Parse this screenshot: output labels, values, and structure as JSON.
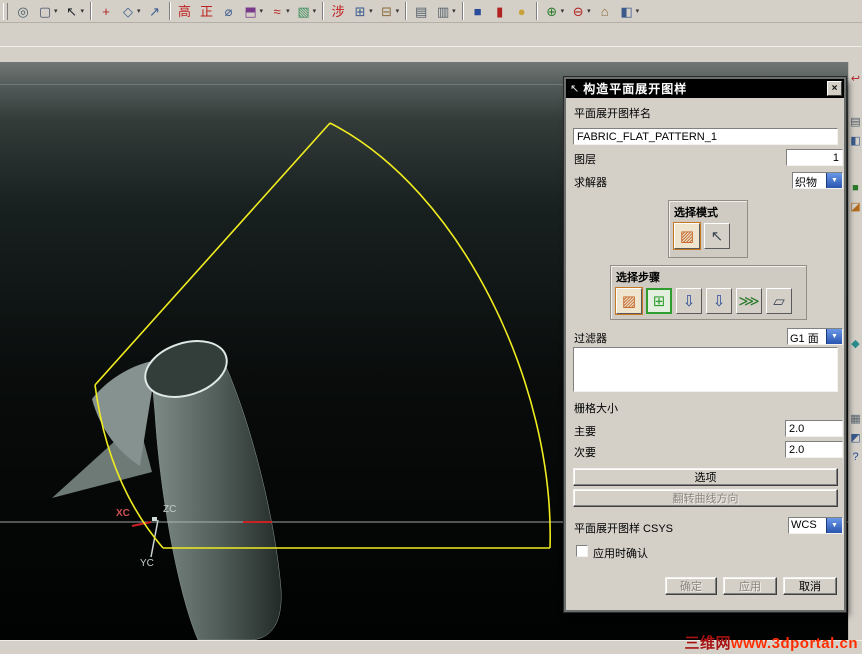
{
  "ui": {
    "dropdown_arrow": "▾",
    "combo_arrow": "▼",
    "close_glyph": "×",
    "title_icon": "↖"
  },
  "toolbar_row1": [
    {
      "grip": true
    },
    {
      "name": "open-part",
      "glyph": "▨",
      "color": "#2a3a55",
      "arrow": true
    },
    {
      "sep": true
    },
    {
      "name": "extrude",
      "glyph": "⬒",
      "color": "#3a5a8c"
    },
    {
      "name": "revolve",
      "glyph": "◑",
      "color": "#3a5a8c"
    },
    {
      "name": "block-feature",
      "glyph": "▣",
      "color": "#3a5a8c"
    },
    {
      "name": "cylinder-feature",
      "glyph": "▮",
      "color": "#3a5a8c",
      "arrow": true
    },
    {
      "name": "cone-feature",
      "glyph": "▲",
      "color": "#3a5a8c",
      "arrow": true
    },
    {
      "name": "sphere-feature",
      "glyph": "●",
      "color": "#3a5a8c"
    },
    {
      "sep": true
    },
    {
      "name": "sheet-body",
      "glyph": "▤",
      "color": "#5a6677"
    },
    {
      "name": "sketch",
      "glyph": "✎",
      "color": "#8a6d1a"
    },
    {
      "sep": true
    },
    {
      "name": "hole-feature",
      "glyph": "◎",
      "color": "#b22222"
    },
    {
      "name": "boss-feature",
      "glyph": "⊚",
      "color": "#3a5a8c"
    },
    {
      "name": "pocket-feature",
      "glyph": "⊟",
      "color": "#3a5a8c",
      "arrow": true
    },
    {
      "name": "pad-feature",
      "glyph": "⊞",
      "color": "#3a5a8c",
      "arrow": true
    },
    {
      "sep": true
    },
    {
      "name": "unite",
      "glyph": "⊕",
      "color": "#b8860b"
    },
    {
      "name": "subtract",
      "glyph": "⊖",
      "color": "#b22222"
    },
    {
      "name": "intersect",
      "glyph": "⊗",
      "color": "#2a7a2a"
    },
    {
      "sep": true
    },
    {
      "name": "edge-blend",
      "glyph": "◠",
      "color": "#3a5a8c",
      "arrow": true
    },
    {
      "name": "chamfer",
      "glyph": "◣",
      "color": "#3a5a8c"
    },
    {
      "name": "shell",
      "glyph": "▢",
      "color": "#3a5a8c"
    },
    {
      "name": "thread",
      "glyph": "≡",
      "color": "#5a6677"
    },
    {
      "sep": true
    },
    {
      "name": "trim-body",
      "glyph": "✂",
      "color": "#b22222"
    },
    {
      "name": "sew",
      "glyph": "≈",
      "color": "#2a7a2a"
    },
    {
      "name": "thicken",
      "glyph": "▦",
      "color": "#3a5a8c",
      "arrow": true
    },
    {
      "sep": true
    },
    {
      "name": "instance-array",
      "glyph": "▩",
      "color": "#7a3a8c"
    },
    {
      "name": "mirror-body",
      "glyph": "◫",
      "color": "#3a5a8c"
    },
    {
      "name": "red-solid",
      "glyph": "■",
      "color": "#b22222"
    },
    {
      "name": "gold-solid",
      "glyph": "■",
      "color": "#caa23a"
    },
    {
      "name": "green-face",
      "glyph": "◨",
      "color": "#2a7a2a"
    }
  ],
  "toolbar_row2": [
    {
      "grip": true
    },
    {
      "name": "snap-point",
      "glyph": "◎",
      "color": "#445a66"
    },
    {
      "name": "selection-rectangle",
      "glyph": "▢",
      "color": "#44506a",
      "arrow": true
    },
    {
      "name": "select-cursor",
      "glyph": "↖",
      "color": "#20262c",
      "arrow": true
    },
    {
      "sep": true
    },
    {
      "name": "point-constructor",
      "glyph": "+",
      "color": "#b22222"
    },
    {
      "name": "plane-constructor",
      "glyph": "◇",
      "color": "#3a5a8c",
      "arrow": true
    },
    {
      "name": "vector-constructor",
      "glyph": "↗",
      "color": "#3a5a8c"
    },
    {
      "sep": true
    },
    {
      "name": "height-analysis",
      "glyph": "高",
      "color": "#c02020"
    },
    {
      "name": "distortion-check",
      "glyph": "正",
      "color": "#c02020"
    },
    {
      "name": "measure-diameter",
      "glyph": "⌀",
      "color": "#3a5a8c"
    },
    {
      "name": "solid-display",
      "glyph": "⬒",
      "color": "#7a3a8c",
      "arrow": true
    },
    {
      "name": "curve-display",
      "glyph": "≈",
      "color": "#b22222",
      "arrow": true
    },
    {
      "name": "surface-display",
      "glyph": "▧",
      "color": "#3a8c5a",
      "arrow": true
    },
    {
      "sep": true
    },
    {
      "name": "flatten-step",
      "glyph": "涉",
      "color": "#c02020"
    },
    {
      "name": "pattern-grid",
      "glyph": "⊞",
      "color": "#3a5a8c",
      "arrow": true
    },
    {
      "name": "offset-grid",
      "glyph": "⊟",
      "color": "#8c6a3a",
      "arrow": true
    },
    {
      "sep": true
    },
    {
      "name": "info-window",
      "glyph": "▤",
      "color": "#55606a"
    },
    {
      "name": "layer-settings",
      "glyph": "▥",
      "color": "#55606a",
      "arrow": true
    },
    {
      "sep": true
    },
    {
      "name": "blue-solid",
      "glyph": "■",
      "color": "#2a4a9a"
    },
    {
      "name": "red-cylinder",
      "glyph": "▮",
      "color": "#b22222"
    },
    {
      "name": "gold-sphere",
      "glyph": "●",
      "color": "#caa23a"
    },
    {
      "sep": true
    },
    {
      "name": "boolean-add",
      "glyph": "⊕",
      "color": "#2a7a2a",
      "arrow": true
    },
    {
      "name": "boolean-cut",
      "glyph": "⊖",
      "color": "#b22222",
      "arrow": true
    },
    {
      "name": "wcs-origin",
      "glyph": "⌂",
      "color": "#8c6a3a"
    },
    {
      "name": "view-style",
      "glyph": "◧",
      "color": "#3a5a8c",
      "arrow": true
    }
  ],
  "right_toolbar": [
    {
      "gap": 8
    },
    {
      "name": "undo-view",
      "glyph": "↩",
      "color": "#b22222"
    },
    {
      "gap": 24
    },
    {
      "name": "list-pane",
      "glyph": "▤",
      "color": "#55606a"
    },
    {
      "name": "split-pane",
      "glyph": "◧",
      "color": "#3a5a8c"
    },
    {
      "gap": 28
    },
    {
      "name": "green-part",
      "glyph": "■",
      "color": "#2a7a2a"
    },
    {
      "name": "orange-part",
      "glyph": "◪",
      "color": "#b26a1a"
    },
    {
      "gap": 118
    },
    {
      "name": "teal-tool",
      "glyph": "◆",
      "color": "#2a8c8c"
    },
    {
      "gap": 56
    },
    {
      "name": "grid-display",
      "glyph": "▦",
      "color": "#55606a"
    },
    {
      "name": "cube-display",
      "glyph": "◩",
      "color": "#3a5a8c"
    },
    {
      "name": "help",
      "glyph": "?",
      "color": "#2a4a9a"
    }
  ],
  "viewport": {
    "axis": {
      "xc": "XC",
      "zc": "ZC",
      "yc": "YC"
    }
  },
  "dialog": {
    "title": "构造平面展开图样",
    "pattern_name_label": "平面展开图样名",
    "pattern_name_value": "FABRIC_FLAT_PATTERN_1",
    "layer_label": "图层",
    "layer_value": "1",
    "solver_label": "求解器",
    "solver_value": "织物",
    "mode_group_label": "选择模式",
    "steps_group_label": "选择步骤",
    "mode_buttons": [
      {
        "name": "fabric-select-mode",
        "glyph": "▨",
        "color": "#c05a1a",
        "state": "active"
      },
      {
        "name": "cursor-select-mode",
        "glyph": "↖",
        "color": "#3a4652",
        "state": ""
      }
    ],
    "step_buttons": [
      {
        "name": "step-select-fabric",
        "glyph": "▨",
        "color": "#c05a1a",
        "state": "active"
      },
      {
        "name": "step-select-grid",
        "glyph": "⊞",
        "color": "#2f9e2f",
        "state": "current"
      },
      {
        "name": "step-insert-point",
        "glyph": "⇩",
        "color": "#2a4a9a",
        "state": ""
      },
      {
        "name": "step-insert-point-2",
        "glyph": "⇩",
        "color": "#2a4a9a",
        "state": ""
      },
      {
        "name": "step-comb-curves",
        "glyph": "⋙",
        "color": "#2a7a2a",
        "state": ""
      },
      {
        "name": "step-target-body",
        "glyph": "▱",
        "color": "#3a4652",
        "state": ""
      }
    ],
    "filter_label": "过滤器",
    "filter_value": "G1 面",
    "grid_size_label": "栅格大小",
    "major_label": "主要",
    "major_value": "2.0",
    "minor_label": "次要",
    "minor_value": "2.0",
    "options_button": "选项",
    "flip_button": "翻转曲线方向",
    "csys_label": "平面展开图样 CSYS",
    "csys_value": "WCS",
    "confirm_label": "应用时确认",
    "ok_button": "确定",
    "apply_button": "应用",
    "cancel_button": "取消"
  },
  "watermark": {
    "site": "三维网",
    "url": "www.3dportal.cn"
  }
}
